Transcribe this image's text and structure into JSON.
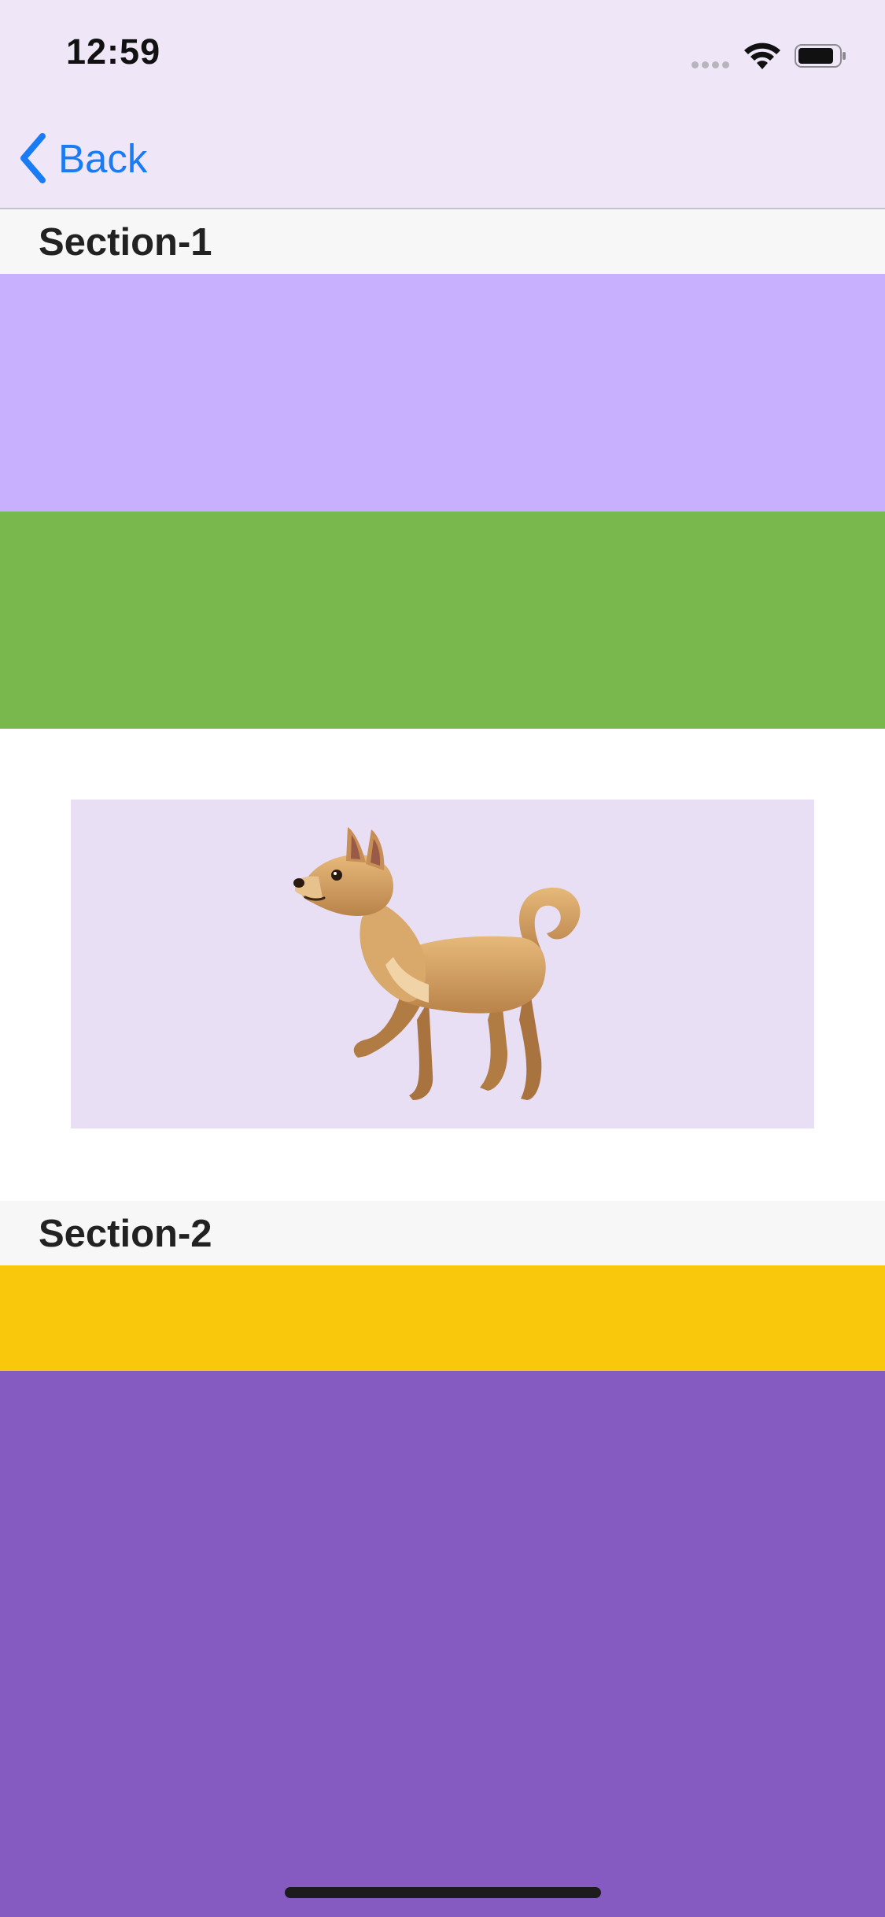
{
  "status_bar": {
    "time": "12:59"
  },
  "nav": {
    "back_label": "Back"
  },
  "sections": [
    {
      "title": "Section-1"
    },
    {
      "title": "Section-2"
    }
  ],
  "colors": {
    "nav_background": "#efe6f8",
    "accent": "#1a7cf5",
    "block_light_purple": "#c8b0fe",
    "block_green": "#78b84d",
    "image_background": "#e8dff5",
    "block_yellow": "#f9c80c",
    "block_dark_purple": "#865bc1"
  },
  "image": {
    "icon": "dog-icon"
  }
}
